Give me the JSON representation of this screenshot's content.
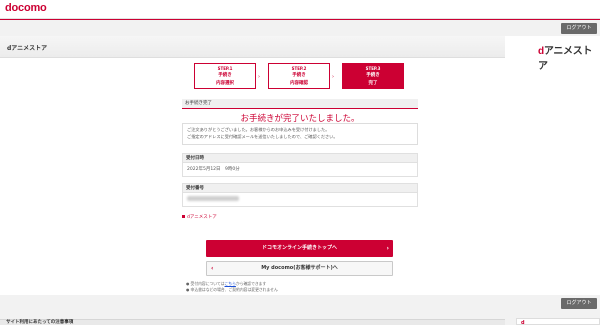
{
  "header": {
    "brand": "docomo",
    "logout_label": "ログアウト"
  },
  "subheader": {
    "title": "dアニメストア",
    "logo_d": "d",
    "logo_text": "アニメストア"
  },
  "steps": [
    {
      "no": "STEP.1",
      "label_line1": "手続き",
      "label_line2": "内容選択",
      "active": false
    },
    {
      "no": "STEP.2",
      "label_line1": "手続き",
      "label_line2": "内容確認",
      "active": false
    },
    {
      "no": "STEP.3",
      "label_line1": "手続き",
      "label_line2": "完了",
      "active": true
    }
  ],
  "complete": {
    "section_label": "お手続き完了",
    "title": "お手続きが完了いたしました。",
    "message_line1": "ご注文ありがとうございました。お客様からのお申込みを受け付けました。",
    "message_line2": "ご指定のアドレスに受付確認メールを送信いたしましたので、ご確認ください。"
  },
  "details": {
    "date_label": "受付日時",
    "date_value": "2022年5月12日　9時0分",
    "number_label": "受付番号"
  },
  "links": {
    "brand_link": "dアニメストア"
  },
  "buttons": {
    "primary": "ドコモオンライン手続きトップへ",
    "secondary": "My docomo(お客様サポート)へ"
  },
  "notes": {
    "note1_prefix": "受付内容については",
    "note1_link": "こちら",
    "note1_suffix": "から確認できます",
    "note2": "申込書はなどの場合、ご契約内容は変更されません"
  },
  "footer": {
    "label": "サイト利用にあたっての注意事項"
  },
  "colors": {
    "brand": "#cc0033",
    "logout_bg": "#6a6a6a"
  }
}
